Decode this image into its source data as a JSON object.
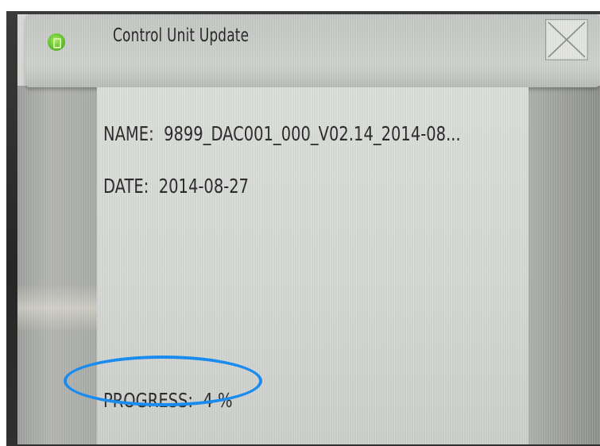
{
  "window": {
    "title": "Control Unit Update",
    "app_icon": "green-update-icon",
    "close_icon": "close-x-icon"
  },
  "update_info": {
    "name_label": "NAME:",
    "name_value": "9899_DAC001_000_V02.14_2014-08...",
    "date_label": "DATE:",
    "date_value": "2014-08-27",
    "progress_label": "PROGRESS:",
    "progress_text": "4 %",
    "progress_percent": 4
  },
  "colors": {
    "icon_accent": "#5fc32a",
    "highlight": "#1a8cf0"
  }
}
